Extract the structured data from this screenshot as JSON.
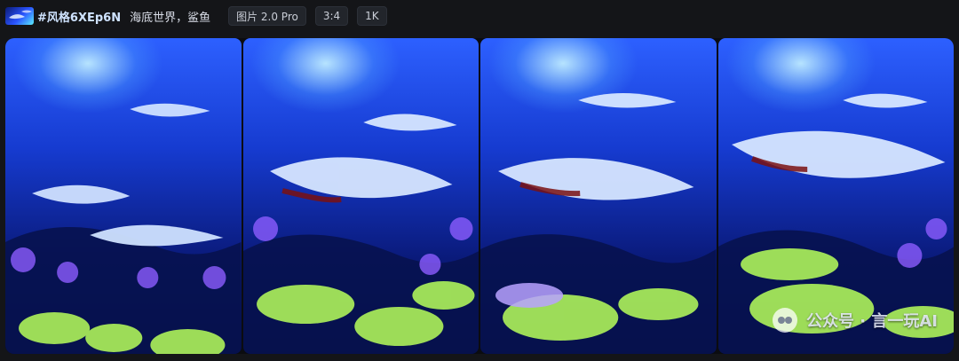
{
  "topbar": {
    "style_tag": "#风格6XEp6N",
    "prompt": "海底世界，鲨鱼",
    "model_badge": "图片 2.0 Pro",
    "ratio_badge": "3:4",
    "resolution_badge": "1K"
  },
  "gallery": {
    "images": [
      {
        "alt": "underwater sharks scene 1"
      },
      {
        "alt": "underwater sharks scene 2"
      },
      {
        "alt": "underwater sharks scene 3"
      },
      {
        "alt": "underwater sharks scene 4"
      }
    ]
  },
  "watermark": {
    "channel": "公众号 · 言一玩AI"
  }
}
